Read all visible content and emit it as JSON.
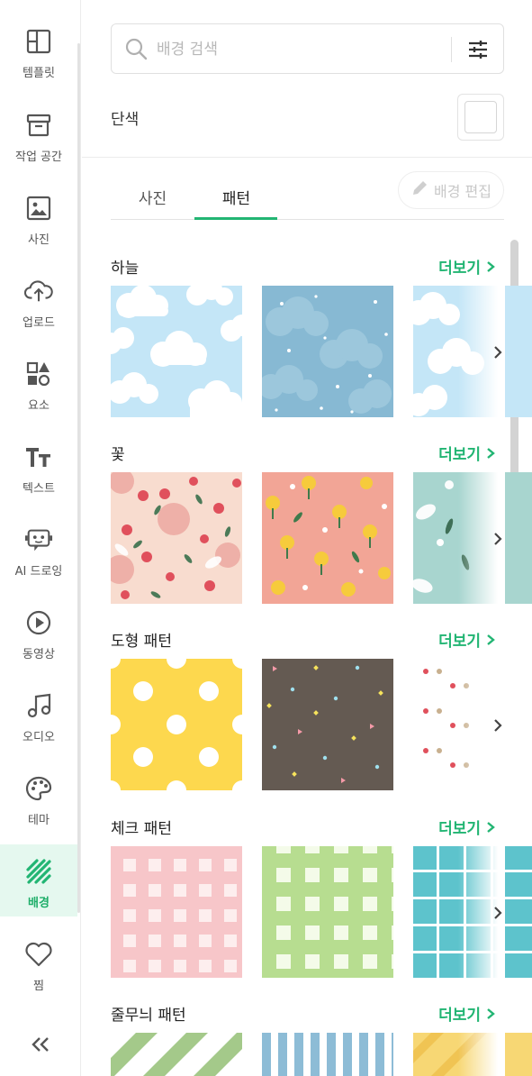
{
  "nav": {
    "items": [
      {
        "label": "템플릿",
        "icon": "template-icon"
      },
      {
        "label": "작업 공간",
        "icon": "archive-icon"
      },
      {
        "label": "사진",
        "icon": "image-icon"
      },
      {
        "label": "업로드",
        "icon": "cloud-upload-icon"
      },
      {
        "label": "요소",
        "icon": "shapes-icon"
      },
      {
        "label": "텍스트",
        "icon": "text-icon"
      },
      {
        "label": "AI 드로잉",
        "icon": "ai-robot-icon"
      },
      {
        "label": "동영상",
        "icon": "play-circle-icon"
      },
      {
        "label": "오디오",
        "icon": "music-note-icon"
      },
      {
        "label": "테마",
        "icon": "palette-icon"
      },
      {
        "label": "배경",
        "icon": "background-stripes-icon",
        "active": true
      },
      {
        "label": "찜",
        "icon": "heart-icon"
      }
    ],
    "collapse_icon": "double-chevron-left-icon"
  },
  "search": {
    "placeholder": "배경 검색",
    "value": ""
  },
  "solid": {
    "label": "단색",
    "color": "#ffffff"
  },
  "tabs": [
    {
      "label": "사진"
    },
    {
      "label": "패턴",
      "active": true
    }
  ],
  "edit_button": {
    "label": "배경 편집"
  },
  "accent_color": "#22b573",
  "sections": [
    {
      "title": "하늘",
      "more": "더보기"
    },
    {
      "title": "꽃",
      "more": "더보기"
    },
    {
      "title": "도형 패턴",
      "more": "더보기"
    },
    {
      "title": "체크 패턴",
      "more": "더보기"
    },
    {
      "title": "줄무늬 패턴",
      "more": "더보기"
    }
  ]
}
